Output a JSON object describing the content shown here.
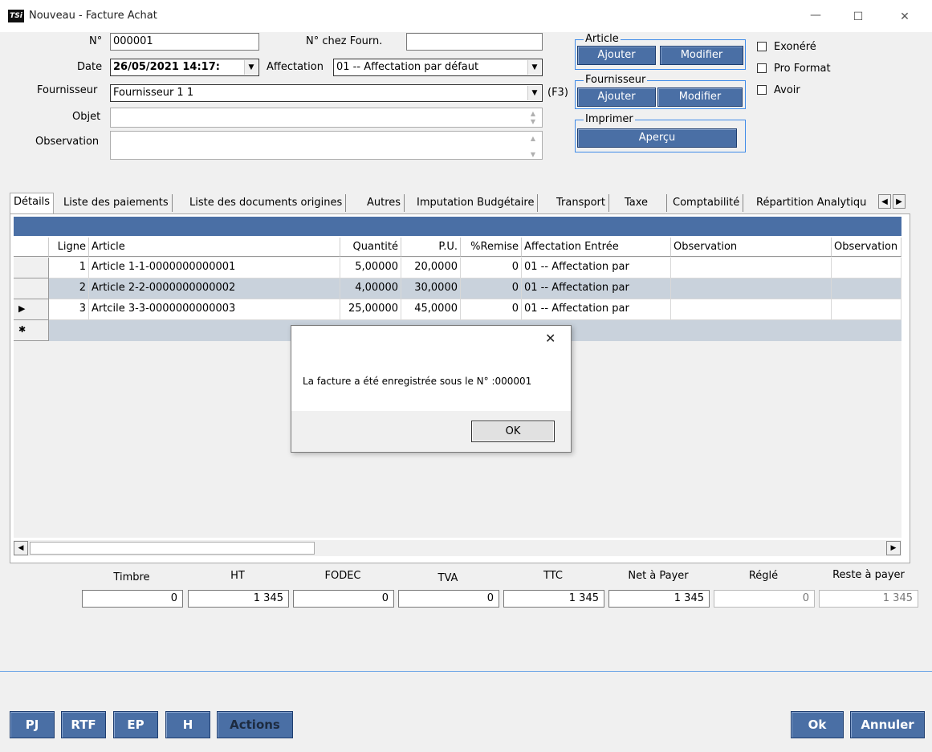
{
  "window": {
    "title": "Nouveau - Facture Achat",
    "logo": "TSi",
    "minimize_icon": "—",
    "maximize_icon": "☐",
    "close_icon": "✕"
  },
  "form": {
    "num_label": "N°",
    "num_value": "000001",
    "num_fourn_label": "N° chez Fourn.",
    "num_fourn_value": "",
    "date_label": "Date",
    "date_value": "26/05/2021 14:17:",
    "affectation_label": "Affectation",
    "affectation_value": "01 -- Affectation par défaut",
    "fournisseur_label": "Fournisseur",
    "fournisseur_value": "Fournisseur 1 1",
    "f3_hint": "(F3)",
    "objet_label": "Objet",
    "objet_value": "",
    "observation_label": "Observation",
    "observation_value": ""
  },
  "groups": {
    "article": {
      "title": "Article",
      "add": "Ajouter",
      "edit": "Modifier"
    },
    "fournisseur": {
      "title": "Fournisseur",
      "add": "Ajouter",
      "edit": "Modifier"
    },
    "imprimer": {
      "title": "Imprimer",
      "preview": "Aperçu"
    }
  },
  "checkboxes": {
    "exonere": "Exonéré",
    "pro_format": "Pro Format",
    "avoir": "Avoir"
  },
  "tabs": [
    "Détails",
    "Liste des paiements",
    "Liste des documents origines",
    "Autres",
    "Imputation Budgétaire",
    "Transport",
    "Taxe",
    "Comptabilité",
    "Répartition Analytiqu"
  ],
  "grid": {
    "columns": [
      "Ligne",
      "Article",
      "Quantité",
      "P.U.",
      "%Remise",
      "Affectation Entrée",
      "Observation",
      "Observation"
    ],
    "rows": [
      {
        "ligne": "1",
        "article": "Article 1-1-0000000000001",
        "quantite": "5,00000",
        "pu": "20,0000",
        "remise": "0",
        "affectation": "01 -- Affectation par"
      },
      {
        "ligne": "2",
        "article": "Article 2-2-0000000000002",
        "quantite": "4,00000",
        "pu": "30,0000",
        "remise": "0",
        "affectation": "01 -- Affectation par"
      },
      {
        "ligne": "3",
        "article": "Artcile 3-3-0000000000003",
        "quantite": "25,00000",
        "pu": "45,0000",
        "remise": "0",
        "affectation": "01 -- Affectation par"
      }
    ],
    "current_row_icon": "▶",
    "new_row_icon": "✱"
  },
  "totals": {
    "timbre_label": "Timbre",
    "timbre": "0",
    "ht_label": "HT",
    "ht": "1 345",
    "fodec_label": "FODEC",
    "fodec": "0",
    "tva_label": "TVA",
    "tva": "0",
    "ttc_label": "TTC",
    "ttc": "1 345",
    "net_label": "Net à Payer",
    "net": "1 345",
    "regle_label": "Réglé",
    "regle": "0",
    "reste_label": "Reste à payer",
    "reste": "1 345"
  },
  "bottom": {
    "pj": "PJ",
    "rtf": "RTF",
    "ep": "EP",
    "h": "H",
    "actions": "Actions",
    "ok": "Ok",
    "annuler": "Annuler"
  },
  "modal": {
    "message": "La facture a été enregistrée sous le N° :000001",
    "ok": "OK",
    "close_icon": "✕"
  },
  "colors": {
    "accent": "#4a6fa5",
    "group_border": "#3f8be8",
    "selected_row": "#c9d2dc"
  }
}
